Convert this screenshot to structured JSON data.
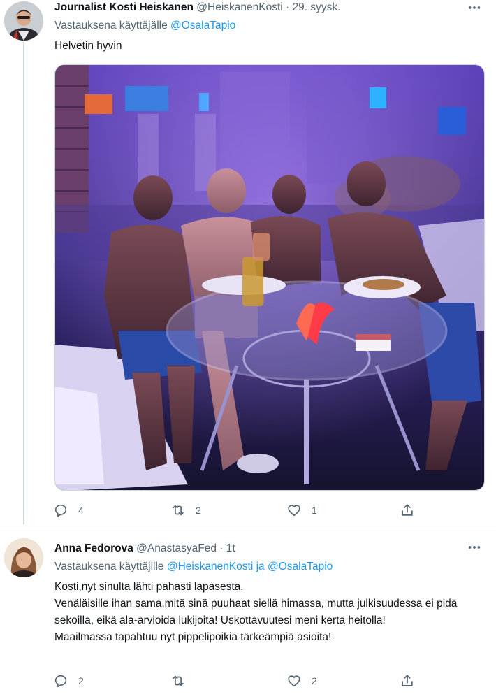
{
  "tweet1": {
    "name": "Journalist Kosti Heiskanen",
    "handle": "@HeiskanenKosti",
    "dot": "·",
    "time": "29. syysk.",
    "replying_prefix": "Vastauksena käyttäjälle",
    "replying_to": "@OsalaTapio",
    "text": "Helvetin hyvin",
    "stats": {
      "replies": "4",
      "retweets": "2",
      "likes": "1"
    }
  },
  "tweet2": {
    "name": "Anna Fedorova",
    "handle": "@AnastasyaFed",
    "dot": "·",
    "time": "1t",
    "replying_prefix": "Vastauksena käyttäjille",
    "replying_to_1": "@HeiskanenKosti",
    "replying_and": "ja",
    "replying_to_2": "@OsalaTapio",
    "text_lines": [
      "Kosti,nyt sinulta lähti pahasti lapasesta.",
      "Venäläisille ihan sama,mitä sinä puuhaat siellä himassa, mutta julkisuudessa ei pidä sekoilla, eikä ala-arvioida lukijoita! Uskottavuutesi meni kerta heitolla!",
      "Maailmassa tapahtuu nyt pippelipoikia tärkeämpiä  asioita!"
    ],
    "stats": {
      "replies": "2",
      "retweets": "",
      "likes": "2"
    }
  },
  "ui": {
    "more_icon": "more-horizontal-icon",
    "accent_color": "#1d9bf0",
    "text_color": "#0f1419",
    "muted_color": "#536471"
  }
}
